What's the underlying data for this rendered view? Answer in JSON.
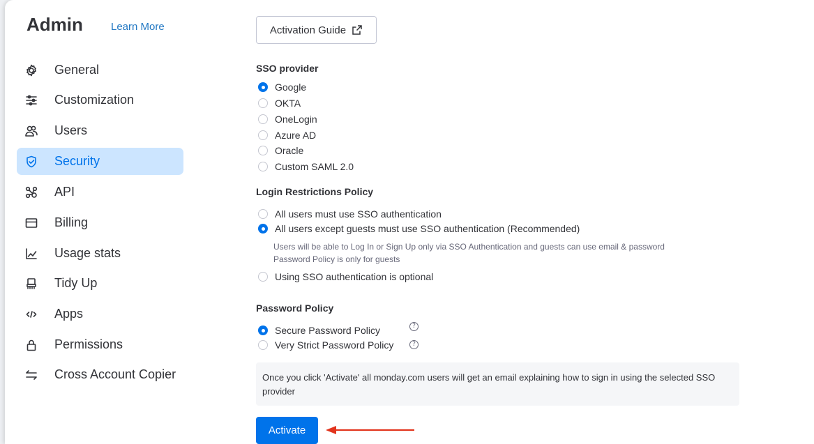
{
  "sidebar": {
    "title": "Admin",
    "learn_more": "Learn More",
    "items": [
      {
        "label": "General",
        "icon": "gear-icon"
      },
      {
        "label": "Customization",
        "icon": "sliders-icon"
      },
      {
        "label": "Users",
        "icon": "users-icon"
      },
      {
        "label": "Security",
        "icon": "shield-icon",
        "active": true
      },
      {
        "label": "API",
        "icon": "api-icon"
      },
      {
        "label": "Billing",
        "icon": "credit-card-icon"
      },
      {
        "label": "Usage stats",
        "icon": "chart-icon"
      },
      {
        "label": "Tidy Up",
        "icon": "broom-icon"
      },
      {
        "label": "Apps",
        "icon": "code-icon"
      },
      {
        "label": "Permissions",
        "icon": "lock-icon"
      },
      {
        "label": "Cross Account Copier",
        "icon": "transfer-icon"
      }
    ]
  },
  "main": {
    "activation_guide": "Activation Guide",
    "sso": {
      "heading": "SSO provider",
      "options": [
        "Google",
        "OKTA",
        "OneLogin",
        "Azure AD",
        "Oracle",
        "Custom SAML 2.0"
      ],
      "selected": "Google"
    },
    "login": {
      "heading": "Login Restrictions Policy",
      "options": [
        "All users must use SSO authentication",
        "All users except guests must use SSO authentication (Recommended)",
        "Using SSO authentication is optional"
      ],
      "selected": "All users except guests must use SSO authentication (Recommended)",
      "note_line1": "Users will be able to Log In or Sign Up only via SSO Authentication and guests can use email & password",
      "note_line2": "Password Policy is only for guests"
    },
    "password": {
      "heading": "Password Policy",
      "options": [
        "Secure Password Policy",
        "Very Strict Password Policy"
      ],
      "selected": "Secure Password Policy",
      "help_glyph": "?"
    },
    "info": "Once you click 'Activate' all monday.com users will get an email explaining how to sign in using the selected SSO provider",
    "activate": "Activate"
  },
  "colors": {
    "accent": "#0073ea",
    "active_bg": "#cce5ff",
    "link": "#1f76c2",
    "arrow": "#e2341d"
  }
}
